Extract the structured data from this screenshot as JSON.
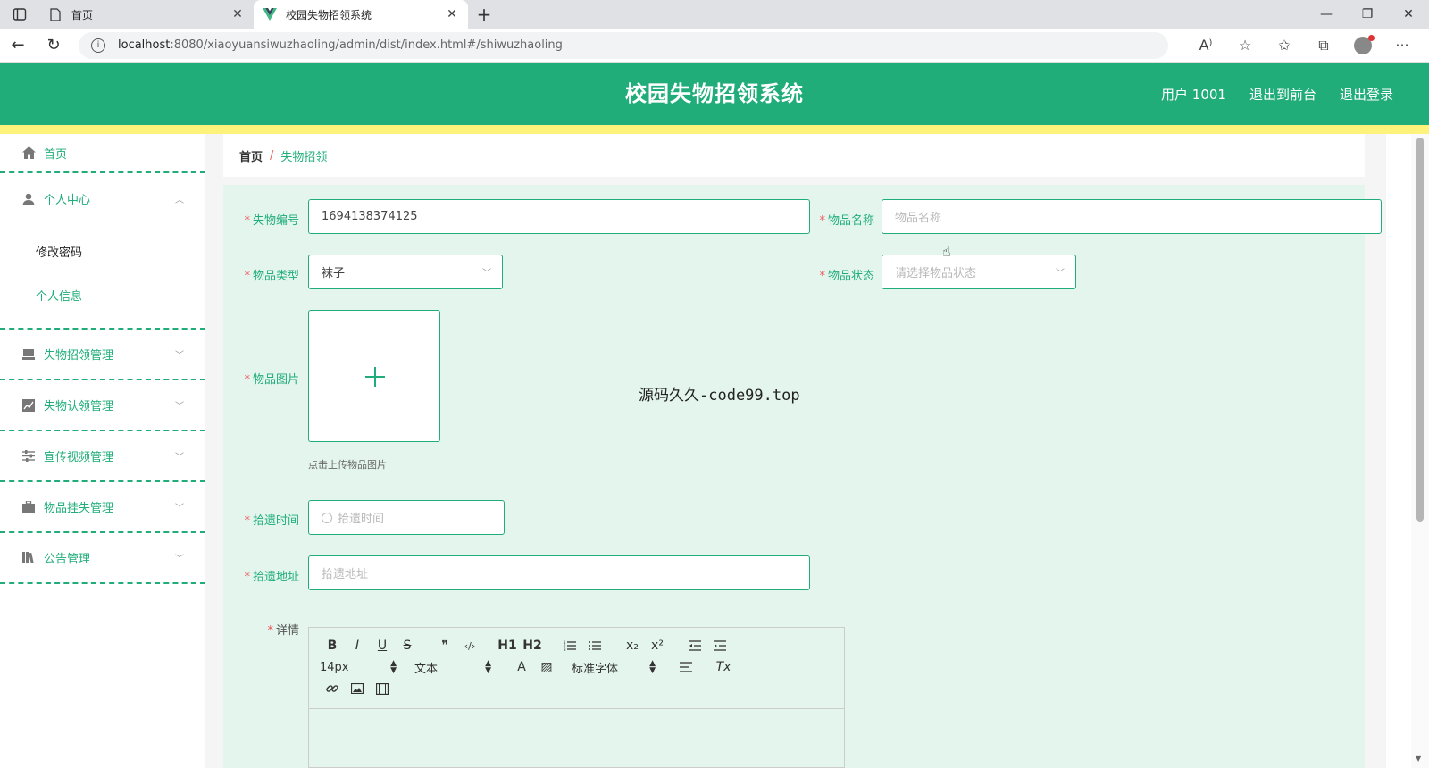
{
  "browser": {
    "tabs": [
      {
        "label": "首页",
        "active": false
      },
      {
        "label": "校园失物招领系统",
        "active": true
      }
    ],
    "url_host": "localhost",
    "url_rest": ":8080/xiaoyuansiwuzhaoling/admin/dist/index.html#/shiwuzhaoling"
  },
  "header": {
    "title": "校园失物招领系统",
    "user": "用户 1001",
    "back_front": "退出到前台",
    "logout": "退出登录"
  },
  "sidebar": {
    "home": "首页",
    "personal_center": "个人中心",
    "sub_change_password": "修改密码",
    "sub_personal_info": "个人信息",
    "lost_found_mgmt": "失物招领管理",
    "claim_mgmt": "失物认领管理",
    "video_mgmt": "宣传视频管理",
    "lost_report_mgmt": "物品挂失管理",
    "notice_mgmt": "公告管理"
  },
  "breadcrumb": {
    "home": "首页",
    "separator": "/",
    "current": "失物招领"
  },
  "form": {
    "item_no_label": "失物编号",
    "item_no_value": "1694138374125",
    "item_name_label": "物品名称",
    "item_name_placeholder": "物品名称",
    "item_type_label": "物品类型",
    "item_type_value": "袜子",
    "item_status_label": "物品状态",
    "item_status_placeholder": "请选择物品状态",
    "image_label": "物品图片",
    "upload_tip": "点击上传物品图片",
    "pickup_time_label": "拾遗时间",
    "pickup_time_placeholder": "拾遗时间",
    "pickup_addr_label": "拾遗地址",
    "pickup_addr_placeholder": "拾遗地址",
    "details_label": "详情",
    "required_mark": "*"
  },
  "editor": {
    "font_size": "14px",
    "paragraph": "文本",
    "font_family": "标准字体",
    "h1": "H1",
    "h2": "H2",
    "bold": "B",
    "italic": "I",
    "underline": "U",
    "strike": "S",
    "quote": "❞",
    "code": "‹/›",
    "sub": "x₂",
    "sup": "x²",
    "clear": "Tx"
  },
  "overlay_text": "源码久久-code99.top",
  "colors": {
    "primary": "#20ad7a",
    "accent_strip": "#fff27a",
    "form_bg": "#e4f5ee"
  }
}
